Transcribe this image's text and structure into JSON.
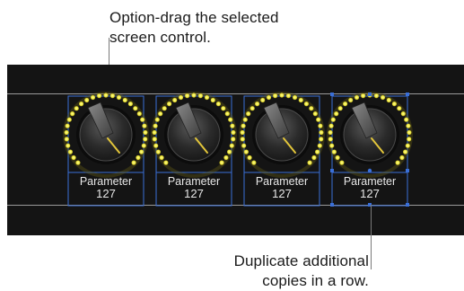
{
  "callouts": {
    "top": [
      "Option-drag the selected",
      "screen control."
    ],
    "bottom": [
      "Duplicate additional",
      "copies in a row."
    ]
  },
  "knobs": [
    {
      "label": "Parameter",
      "value": "127",
      "selected": false
    },
    {
      "label": "Parameter",
      "value": "127",
      "selected": false
    },
    {
      "label": "Parameter",
      "value": "127",
      "selected": false
    },
    {
      "label": "Parameter",
      "value": "127",
      "selected": true
    }
  ],
  "colors": {
    "canvas": "#141414",
    "led_yellow": "#f4f04a",
    "indicator": "#e2c53a",
    "selection_outline": "#3a6fd8",
    "label_text": "#e8e8e8"
  }
}
